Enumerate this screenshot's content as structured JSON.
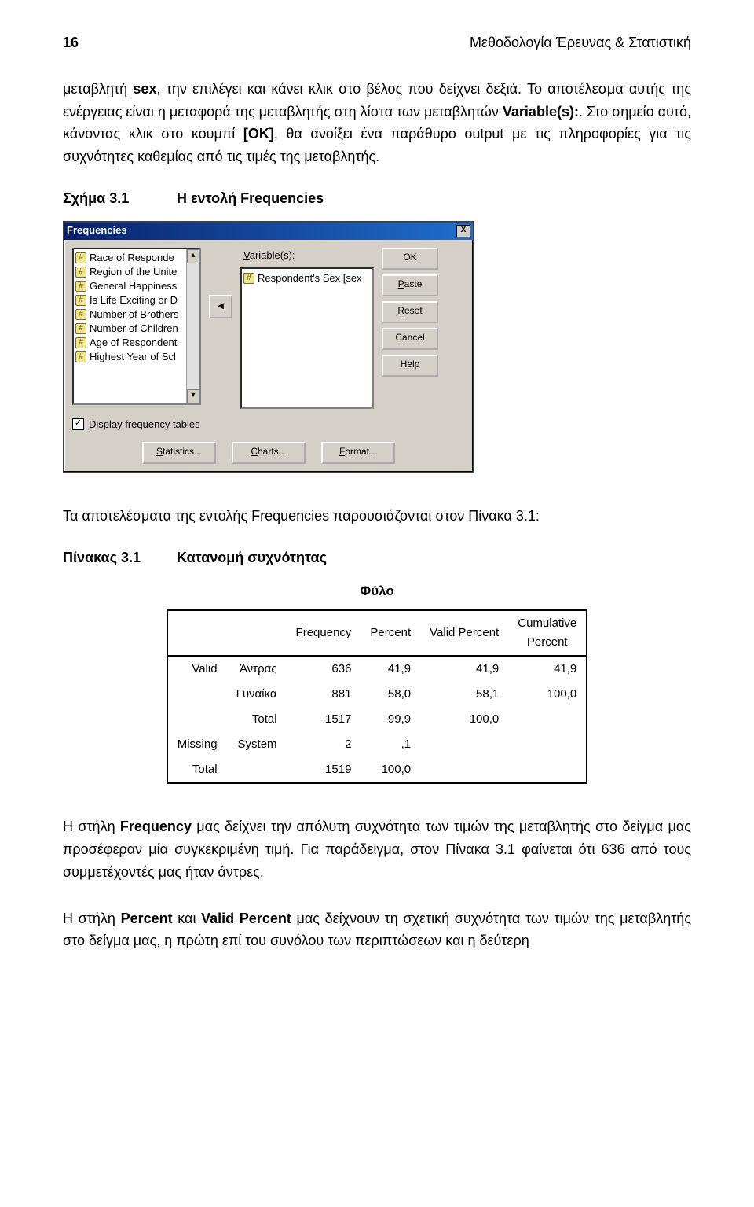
{
  "header": {
    "page_number": "16",
    "section": "Μεθοδολογία Έρευνας & Στατιστική"
  },
  "para1": "μεταβλητή ",
  "para1_sex": "sex",
  "para1_cont": ", την επιλέγει και κάνει κλικ στο βέλος που δείχνει δεξιά. Το αποτέλεσμα αυτής της ενέργειας είναι η μεταφορά της μεταβλητής στη λίστα των μεταβλητών ",
  "para1_vars": "Variable(s):",
  "para1_after": ". Στο σημείο αυτό, κάνοντας κλικ στο κουμπί ",
  "para1_ok": "[ΟΚ]",
  "para1_end": ", θα ανοίξει ένα παράθυρο output με τις πληροφορίες για τις συχνότητες καθεμίας από τις τιμές της μεταβλητής.",
  "schema": {
    "label": "Σχήμα 3.1",
    "title": "Η εντολή Frequencies"
  },
  "dialog": {
    "title": "Frequencies",
    "close": "X",
    "variables_label": "Variable(s):",
    "source_list": [
      "Race of Responde",
      "Region of the Unite",
      "General Happiness",
      "Is Life Exciting or D",
      "Number of Brothers",
      "Number of Children",
      "Age of Respondent",
      "Highest Year of Scl"
    ],
    "selected_item": "Respondent's Sex [sex",
    "arrow": "◂",
    "up": "▴",
    "down": "▾",
    "buttons": {
      "ok": "OK",
      "paste": "Paste",
      "reset": "Reset",
      "cancel": "Cancel",
      "help": "Help"
    },
    "display_freq": {
      "check": "✓",
      "label_d": "D",
      "label_rest": "isplay frequency tables"
    },
    "bottom": {
      "statistics": "Statistics...",
      "charts": "Charts...",
      "format": "Format..."
    },
    "stat_u": "S",
    "chart_u": "C",
    "format_u": "F"
  },
  "results_para": "Τα αποτελέσματα της εντολής Frequencies  παρουσιάζονται στον Πίνακα 3.1:",
  "pinak": {
    "label": "Πίνακας 3.1",
    "title": "Κατανομή συχνότητας"
  },
  "table_title": "Φύλο",
  "chart_data": {
    "type": "table",
    "columns": [
      "",
      "",
      "Frequency",
      "Percent",
      "Valid Percent",
      "Cumulative Percent"
    ],
    "rows": [
      {
        "group": "Valid",
        "label": "Άντρας",
        "frequency": "636",
        "percent": "41,9",
        "valid_percent": "41,9",
        "cumulative": "41,9"
      },
      {
        "group": "",
        "label": "Γυναίκα",
        "frequency": "881",
        "percent": "58,0",
        "valid_percent": "58,1",
        "cumulative": "100,0"
      },
      {
        "group": "",
        "label": "Total",
        "frequency": "1517",
        "percent": "99,9",
        "valid_percent": "100,0",
        "cumulative": ""
      },
      {
        "group": "Missing",
        "label": "System",
        "frequency": "2",
        "percent": ",1",
        "valid_percent": "",
        "cumulative": ""
      },
      {
        "group": "Total",
        "label": "",
        "frequency": "1519",
        "percent": "100,0",
        "valid_percent": "",
        "cumulative": ""
      }
    ]
  },
  "para_freq": {
    "pre": "Η στήλη ",
    "b": "Frequency",
    "mid": " μας δείχνει την απόλυτη συχνότητα των τιμών της μεταβλητής στο δείγμα μας προσέφεραν μία συγκεκριμένη τιμή. Για παράδειγμα, στον Πίνακα 3.1 φαίνεται ότι 636 από τους συμμετέχοντές μας ήταν άντρες."
  },
  "para_percent": {
    "pre": "Η στήλη ",
    "b1": "Percent",
    "mid1": " και ",
    "b2": "Valid Percent",
    "mid2": " μας δείχνουν τη σχετική συχνότητα των τιμών της μεταβλητής στο δείγμα μας, η πρώτη επί του συνόλου των περιπτώσεων και η δεύτερη"
  }
}
